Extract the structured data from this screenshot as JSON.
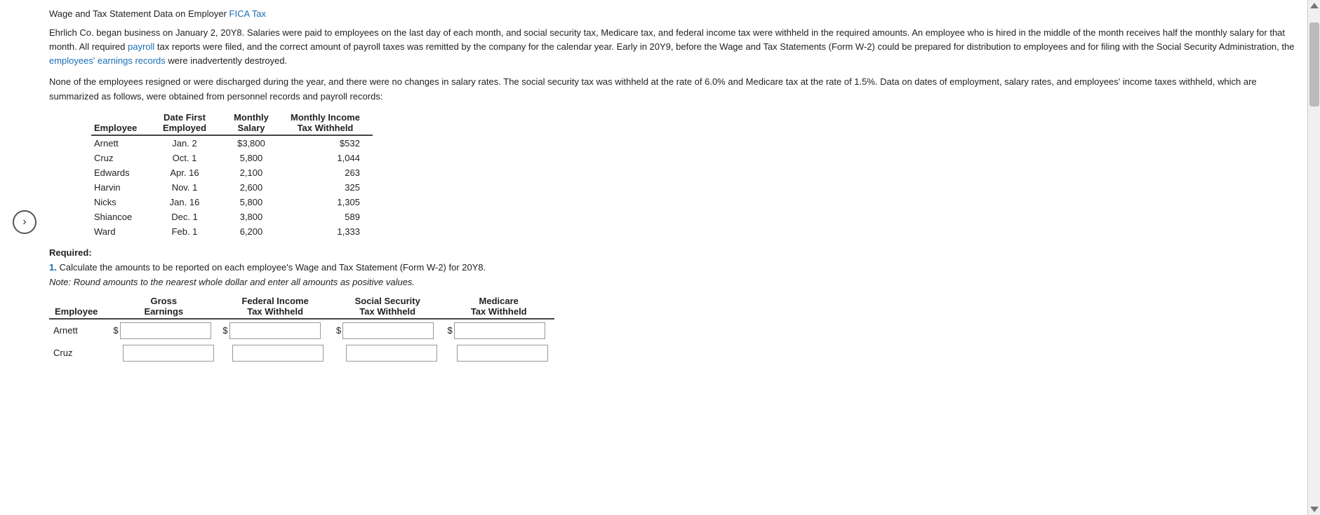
{
  "title": {
    "text": "Wage and Tax Statement Data on Employer",
    "link1_text": "FICA Tax",
    "link1_href": "#"
  },
  "paragraphs": [
    {
      "id": "p1",
      "text_parts": [
        {
          "text": "Ehrlich Co. began business on January 2, 20Y8. Salaries were paid to employees on the last day of each month, and social security tax, Medicare tax, and federal income tax were withheld in the required amounts. An employee who is hired in the middle of the month receives half the monthly salary for that month. All required ",
          "type": "normal"
        },
        {
          "text": "payroll",
          "type": "link"
        },
        {
          "text": " tax reports were filed, and the correct amount of payroll taxes was remitted by the company for the calendar year. Early in 20Y9, before the Wage and Tax Statements (Form W-2) could be prepared for distribution to employees and for filing with the Social Security Administration, the ",
          "type": "normal"
        },
        {
          "text": "employees' earnings records",
          "type": "link"
        },
        {
          "text": " were inadvertently destroyed.",
          "type": "normal"
        }
      ]
    },
    {
      "id": "p2",
      "text": "None of the employees resigned or were discharged during the year, and there were no changes in salary rates. The social security tax was withheld at the rate of 6.0% and Medicare tax at the rate of 1.5%. Data on dates of employment, salary rates, and employees' income taxes withheld, which are summarized as follows, were obtained from personnel records and payroll records:"
    }
  ],
  "emp_table": {
    "headers": [
      {
        "label": "Employee",
        "sub": ""
      },
      {
        "label": "Date First",
        "sub": "Employed"
      },
      {
        "label": "Monthly",
        "sub": "Salary"
      },
      {
        "label": "Monthly Income",
        "sub": "Tax Withheld"
      }
    ],
    "rows": [
      {
        "employee": "Arnett",
        "date_first": "Jan. 2",
        "monthly_salary": "$3,800",
        "monthly_income_tax": "$532"
      },
      {
        "employee": "Cruz",
        "date_first": "Oct. 1",
        "monthly_salary": "5,800",
        "monthly_income_tax": "1,044"
      },
      {
        "employee": "Edwards",
        "date_first": "Apr. 16",
        "monthly_salary": "2,100",
        "monthly_income_tax": "263"
      },
      {
        "employee": "Harvin",
        "date_first": "Nov. 1",
        "monthly_salary": "2,600",
        "monthly_income_tax": "325"
      },
      {
        "employee": "Nicks",
        "date_first": "Jan. 16",
        "monthly_salary": "5,800",
        "monthly_income_tax": "1,305"
      },
      {
        "employee": "Shiancoe",
        "date_first": "Dec. 1",
        "monthly_salary": "3,800",
        "monthly_income_tax": "589"
      },
      {
        "employee": "Ward",
        "date_first": "Feb. 1",
        "monthly_salary": "6,200",
        "monthly_income_tax": "1,333"
      }
    ]
  },
  "required_label": "Required:",
  "question1": {
    "number": "1.",
    "text": "Calculate the amounts to be reported on each employee's Wage and Tax Statement (Form W-2) for 20Y8."
  },
  "note": "Note: Round amounts to the nearest whole dollar and enter all amounts as positive values.",
  "input_table": {
    "headers": [
      {
        "label": "Employee",
        "align": "left"
      },
      {
        "label": "Gross\nEarnings",
        "align": "center"
      },
      {
        "label": "Federal Income\nTax Withheld",
        "align": "center"
      },
      {
        "label": "Social Security\nTax Withheld",
        "align": "center"
      },
      {
        "label": "Medicare\nTax Withheld",
        "align": "center"
      }
    ],
    "rows": [
      {
        "employee": "Arnett",
        "has_dollar": true
      },
      {
        "employee": "Cruz",
        "has_dollar": false
      }
    ]
  },
  "nav_button": {
    "label": ">"
  }
}
